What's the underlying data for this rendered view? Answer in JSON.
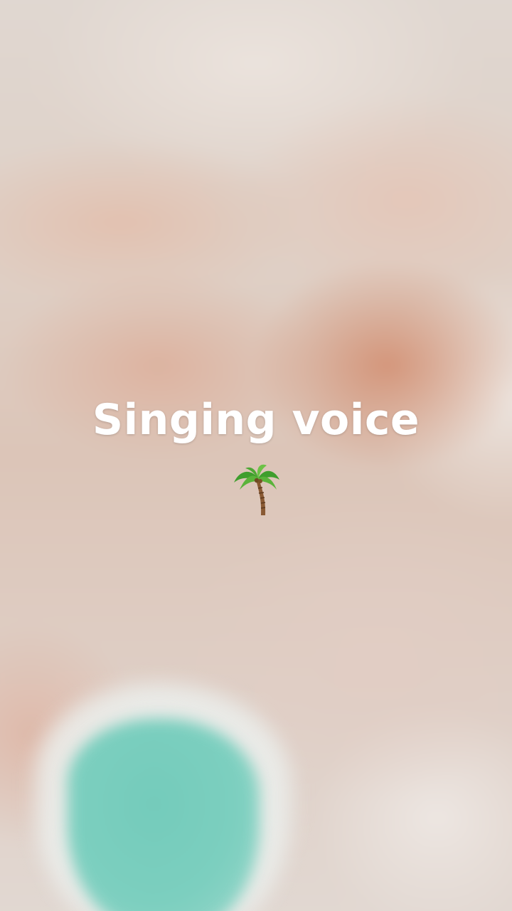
{
  "caption": {
    "title": "Singing voice",
    "emoji": "palm-tree-icon"
  },
  "colors": {
    "caption_text": "#ffffff",
    "pool": "#7ccfbf",
    "background": "#ddd2ca",
    "warm_blob": "#d28c6e"
  }
}
